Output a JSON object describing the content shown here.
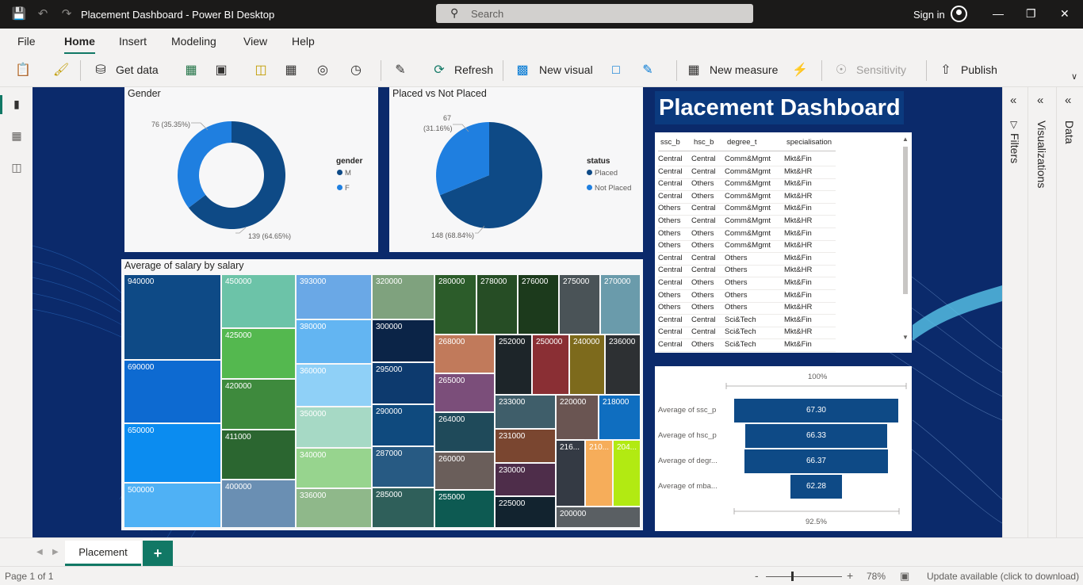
{
  "app": {
    "title": "Placement Dashboard - Power BI Desktop",
    "search_placeholder": "Search",
    "sign_in": "Sign in"
  },
  "menu": {
    "items": [
      "File",
      "Home",
      "Insert",
      "Modeling",
      "View",
      "Help"
    ],
    "active": "Home"
  },
  "ribbon": {
    "get_data": "Get data",
    "refresh": "Refresh",
    "new_visual": "New visual",
    "new_measure": "New measure",
    "sensitivity": "Sensitivity",
    "publish": "Publish"
  },
  "gender_chart": {
    "title": "Gender",
    "legend_title": "gender",
    "legend": [
      {
        "label": "M",
        "color": "#0e4a86"
      },
      {
        "label": "F",
        "color": "#1f7fe0"
      }
    ],
    "label_m": "139 (64.65%)",
    "label_f": "76 (35.35%)"
  },
  "placement_chart": {
    "title": "Placed vs Not Placed",
    "legend_title": "status",
    "legend": [
      {
        "label": "Placed",
        "color": "#0e4a86"
      },
      {
        "label": "Not Placed",
        "color": "#1f7fe0"
      }
    ],
    "label_placed": "148 (68.84%)",
    "label_not_placed_1": "67",
    "label_not_placed_2": "(31.16%)"
  },
  "chart_data": [
    {
      "type": "pie",
      "title": "Gender",
      "variant": "donut",
      "categories": [
        "M",
        "F"
      ],
      "values": [
        139,
        76
      ],
      "colors": [
        "#0e4a86",
        "#1f7fe0"
      ]
    },
    {
      "type": "pie",
      "title": "Placed vs Not Placed",
      "categories": [
        "Placed",
        "Not Placed"
      ],
      "values": [
        148,
        67
      ],
      "colors": [
        "#0e4a86",
        "#1f7fe0"
      ]
    },
    {
      "type": "bar",
      "orientation": "horizontal",
      "categories": [
        "Average of ssc_p",
        "Average of hsc_p",
        "Average of degr...",
        "Average of mba..."
      ],
      "values": [
        67.3,
        66.33,
        66.37,
        62.28
      ],
      "value_labels": [
        "67.30",
        "66.33",
        "66.37",
        "62.28"
      ],
      "top_label": "100%",
      "bottom_label": "92.5%"
    }
  ],
  "treemap": {
    "title": "Average of salary by salary",
    "cells": [
      "940000",
      "690000",
      "650000",
      "500000",
      "450000",
      "425000",
      "420000",
      "411000",
      "400000",
      "393000",
      "380000",
      "360000",
      "350000",
      "340000",
      "336000",
      "320000",
      "300000",
      "295000",
      "290000",
      "287000",
      "285000",
      "280000",
      "278000",
      "276000",
      "275000",
      "270000",
      "268000",
      "265000",
      "264000",
      "260000",
      "255000",
      "252000",
      "250000",
      "240000",
      "236000",
      "233000",
      "231000",
      "230000",
      "225000",
      "220000",
      "218000",
      "216...",
      "210...",
      "204...",
      "200000"
    ]
  },
  "dashboard_title": "Placement Dashboard",
  "table": {
    "columns": [
      "ssc_b",
      "hsc_b",
      "degree_t",
      "specialisation"
    ],
    "rows": [
      [
        "Central",
        "Central",
        "Comm&Mgmt",
        "Mkt&Fin"
      ],
      [
        "Central",
        "Central",
        "Comm&Mgmt",
        "Mkt&HR"
      ],
      [
        "Central",
        "Others",
        "Comm&Mgmt",
        "Mkt&Fin"
      ],
      [
        "Central",
        "Others",
        "Comm&Mgmt",
        "Mkt&HR"
      ],
      [
        "Others",
        "Central",
        "Comm&Mgmt",
        "Mkt&Fin"
      ],
      [
        "Others",
        "Central",
        "Comm&Mgmt",
        "Mkt&HR"
      ],
      [
        "Others",
        "Others",
        "Comm&Mgmt",
        "Mkt&Fin"
      ],
      [
        "Others",
        "Others",
        "Comm&Mgmt",
        "Mkt&HR"
      ],
      [
        "Central",
        "Central",
        "Others",
        "Mkt&Fin"
      ],
      [
        "Central",
        "Central",
        "Others",
        "Mkt&HR"
      ],
      [
        "Central",
        "Others",
        "Others",
        "Mkt&Fin"
      ],
      [
        "Others",
        "Others",
        "Others",
        "Mkt&Fin"
      ],
      [
        "Others",
        "Others",
        "Others",
        "Mkt&HR"
      ],
      [
        "Central",
        "Central",
        "Sci&Tech",
        "Mkt&Fin"
      ],
      [
        "Central",
        "Central",
        "Sci&Tech",
        "Mkt&HR"
      ],
      [
        "Central",
        "Others",
        "Sci&Tech",
        "Mkt&Fin"
      ]
    ]
  },
  "panes": {
    "filters": "Filters",
    "visualizations": "Visualizations",
    "data": "Data"
  },
  "tabs": {
    "page": "Placement",
    "add": "+"
  },
  "status": {
    "page_info": "Page 1 of 1",
    "zoom": "78%",
    "update": "Update available (click to download)",
    "zoom_minus": "-",
    "zoom_plus": "+"
  }
}
